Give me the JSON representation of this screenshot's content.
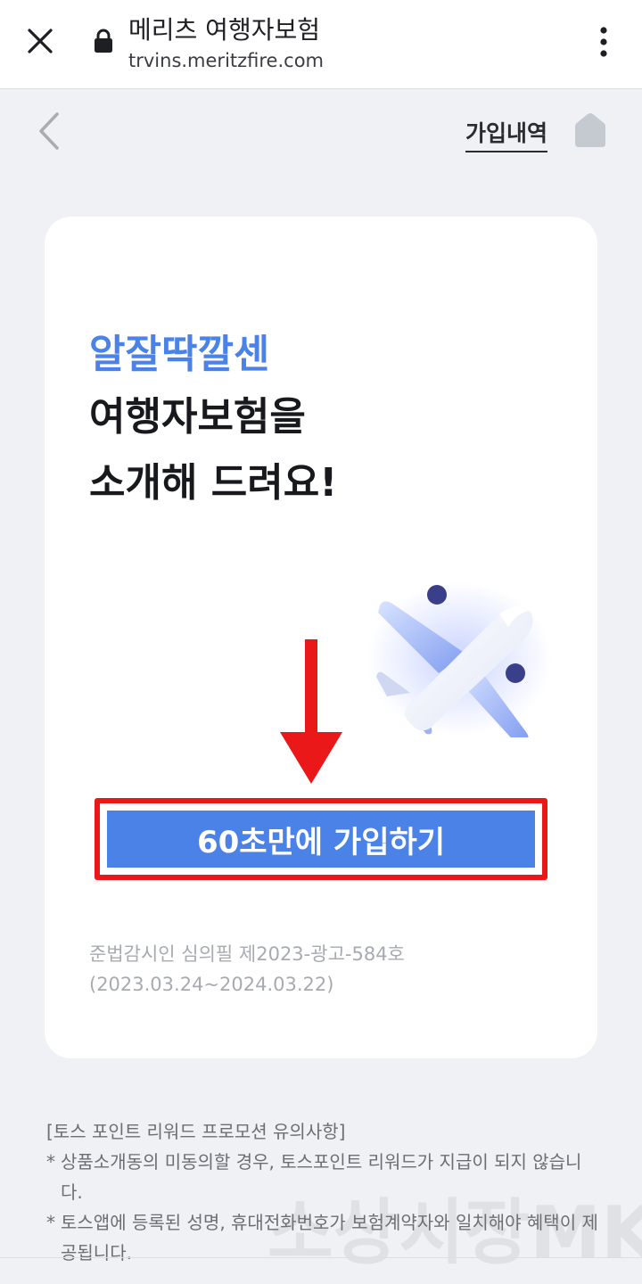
{
  "browser": {
    "title": "메리츠 여행자보험",
    "url": "trvins.meritzfire.com"
  },
  "nav": {
    "history_label": "가입내역"
  },
  "hero": {
    "accent_line": "알잘딱깔센",
    "line2": "여행자보험을",
    "line3": "소개해 드려요!"
  },
  "cta": {
    "label": "60초만에 가입하기"
  },
  "disclaimer": {
    "line1": "준법감시인 심의필 제2023-광고-584호",
    "line2": "(2023.03.24~2024.03.22)"
  },
  "notice": {
    "title": "[토스 포인트 리워드 프로모션 유의사항]",
    "items": [
      "상품소개동의 미동의할 경우, 토스포인트 리워드가 지급이 되지 않습니다.",
      "토스앱에 등록된 성명, 휴대전화번호가 보험계약자와 일치해야 혜택이 제공됩니다."
    ],
    "bullet": "*"
  },
  "watermark": "소상시장MK",
  "colors": {
    "accent": "#4a82e8",
    "highlight_red": "#ea1818",
    "background": "#eff1f4"
  },
  "icons": {
    "close": "close-icon",
    "lock": "lock-icon",
    "menu": "kebab-menu-icon",
    "back": "back-arrow-icon",
    "home": "home-icon",
    "plane": "airplane-icon",
    "arrow": "down-arrow-icon"
  }
}
